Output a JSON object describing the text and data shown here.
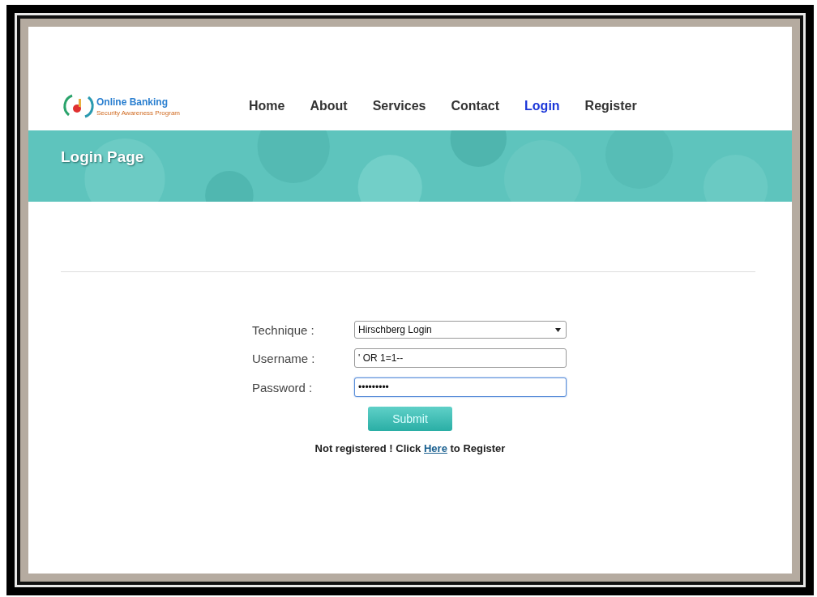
{
  "logo": {
    "title": "Online Banking",
    "tagline": "Security Awareness Program"
  },
  "nav": [
    {
      "label": "Home",
      "selected": false
    },
    {
      "label": "About",
      "selected": false
    },
    {
      "label": "Services",
      "selected": false
    },
    {
      "label": "Contact",
      "selected": false
    },
    {
      "label": "Login",
      "selected": true
    },
    {
      "label": "Register",
      "selected": false
    }
  ],
  "banner": {
    "title": "Login Page",
    "kind": "picture"
  },
  "form": {
    "fields": [
      {
        "label": "Technique :",
        "kind": "select",
        "value": "Hirschberg Login",
        "focused": false
      },
      {
        "label": "Username :",
        "kind": "text",
        "value": "' OR 1=1--",
        "focused": false
      },
      {
        "label": "Password :",
        "kind": "text",
        "value": "•••••••••",
        "focused": true
      }
    ],
    "submit": "Submit",
    "footer": {
      "before": "Not registered ! Click",
      "link": "Here",
      "after": "to Register"
    }
  }
}
